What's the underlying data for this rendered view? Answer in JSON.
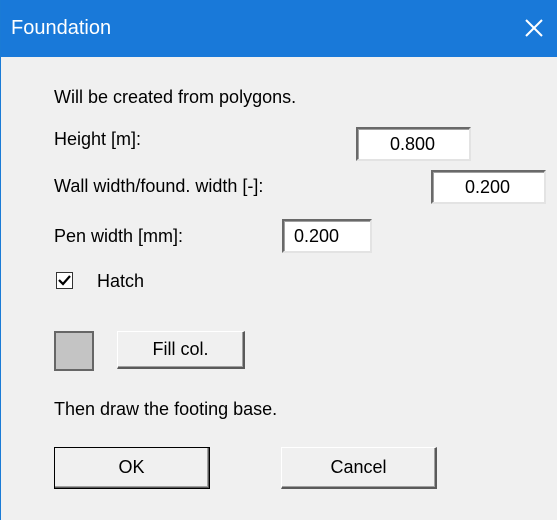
{
  "window": {
    "title": "Foundation",
    "close_icon": "close-icon"
  },
  "content": {
    "intro": "Will be created from polygons.",
    "height_label": "Height [m]:",
    "height_value": "0.800",
    "wall_label": "Wall width/found. width [-]:",
    "wall_value": "0.200",
    "pen_label": "Pen width [mm]:",
    "pen_value": "0.200",
    "hatch_label": "Hatch",
    "hatch_checked": true,
    "fill_label": "Fill col.",
    "fill_color": "#c4c4c4",
    "instruction": "Then draw the footing base."
  },
  "buttons": {
    "ok": "OK",
    "cancel": "Cancel"
  },
  "colors": {
    "titlebar": "#1979d9",
    "dialog_bg": "#f0f0f0"
  }
}
